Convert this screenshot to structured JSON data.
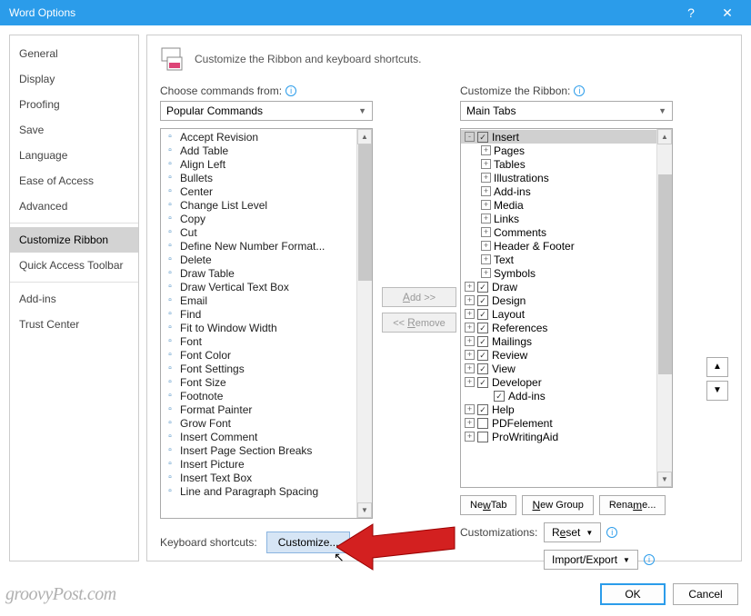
{
  "title": "Word Options",
  "sidebar": {
    "items": [
      "General",
      "Display",
      "Proofing",
      "Save",
      "Language",
      "Ease of Access",
      "Advanced",
      "Customize Ribbon",
      "Quick Access Toolbar",
      "Add-ins",
      "Trust Center"
    ],
    "selected_index": 7
  },
  "header": "Customize the Ribbon and keyboard shortcuts.",
  "left_label": "Choose commands from:",
  "left_dropdown": "Popular Commands",
  "right_label": "Customize the Ribbon:",
  "right_dropdown": "Main Tabs",
  "commands": [
    {
      "label": "Accept Revision",
      "arrow": false
    },
    {
      "label": "Add Table",
      "arrow": true
    },
    {
      "label": "Align Left",
      "arrow": false
    },
    {
      "label": "Bullets",
      "arrow": true
    },
    {
      "label": "Center",
      "arrow": false
    },
    {
      "label": "Change List Level",
      "arrow": true
    },
    {
      "label": "Copy",
      "arrow": false
    },
    {
      "label": "Cut",
      "arrow": false
    },
    {
      "label": "Define New Number Format...",
      "arrow": false
    },
    {
      "label": "Delete",
      "arrow": false
    },
    {
      "label": "Draw Table",
      "arrow": false
    },
    {
      "label": "Draw Vertical Text Box",
      "arrow": false
    },
    {
      "label": "Email",
      "arrow": false
    },
    {
      "label": "Find",
      "arrow": false
    },
    {
      "label": "Fit to Window Width",
      "arrow": false
    },
    {
      "label": "Font",
      "arrow": true
    },
    {
      "label": "Font Color",
      "arrow": true
    },
    {
      "label": "Font Settings",
      "arrow": false
    },
    {
      "label": "Font Size",
      "arrow": true
    },
    {
      "label": "Footnote",
      "arrow": false
    },
    {
      "label": "Format Painter",
      "arrow": false
    },
    {
      "label": "Grow Font",
      "arrow": false
    },
    {
      "label": "Insert Comment",
      "arrow": false
    },
    {
      "label": "Insert Page  Section Breaks",
      "arrow": true
    },
    {
      "label": "Insert Picture",
      "arrow": false
    },
    {
      "label": "Insert Text Box",
      "arrow": false
    },
    {
      "label": "Line and Paragraph Spacing",
      "arrow": true
    }
  ],
  "mid_add": "Add >>",
  "mid_remove": "<< Remove",
  "tree": [
    {
      "indent": 0,
      "exp": "-",
      "chk": true,
      "label": "Insert",
      "sel": true
    },
    {
      "indent": 1,
      "exp": "+",
      "chk": null,
      "label": "Pages"
    },
    {
      "indent": 1,
      "exp": "+",
      "chk": null,
      "label": "Tables"
    },
    {
      "indent": 1,
      "exp": "+",
      "chk": null,
      "label": "Illustrations"
    },
    {
      "indent": 1,
      "exp": "+",
      "chk": null,
      "label": "Add-ins"
    },
    {
      "indent": 1,
      "exp": "+",
      "chk": null,
      "label": "Media"
    },
    {
      "indent": 1,
      "exp": "+",
      "chk": null,
      "label": "Links"
    },
    {
      "indent": 1,
      "exp": "+",
      "chk": null,
      "label": "Comments"
    },
    {
      "indent": 1,
      "exp": "+",
      "chk": null,
      "label": "Header & Footer"
    },
    {
      "indent": 1,
      "exp": "+",
      "chk": null,
      "label": "Text"
    },
    {
      "indent": 1,
      "exp": "+",
      "chk": null,
      "label": "Symbols"
    },
    {
      "indent": 0,
      "exp": "+",
      "chk": true,
      "label": "Draw"
    },
    {
      "indent": 0,
      "exp": "+",
      "chk": true,
      "label": "Design"
    },
    {
      "indent": 0,
      "exp": "+",
      "chk": true,
      "label": "Layout"
    },
    {
      "indent": 0,
      "exp": "+",
      "chk": true,
      "label": "References"
    },
    {
      "indent": 0,
      "exp": "+",
      "chk": true,
      "label": "Mailings"
    },
    {
      "indent": 0,
      "exp": "+",
      "chk": true,
      "label": "Review"
    },
    {
      "indent": 0,
      "exp": "+",
      "chk": true,
      "label": "View"
    },
    {
      "indent": 0,
      "exp": "+",
      "chk": true,
      "label": "Developer"
    },
    {
      "indent": 1,
      "exp": "",
      "chk": true,
      "label": "Add-ins"
    },
    {
      "indent": 0,
      "exp": "+",
      "chk": true,
      "label": "Help"
    },
    {
      "indent": 0,
      "exp": "+",
      "chk": false,
      "label": "PDFelement"
    },
    {
      "indent": 0,
      "exp": "+",
      "chk": false,
      "label": "ProWritingAid"
    }
  ],
  "new_tab": "New Tab",
  "new_group": "New Group",
  "rename": "Rename...",
  "customizations_label": "Customizations:",
  "reset": "Reset",
  "import_export": "Import/Export",
  "kbs_label": "Keyboard shortcuts:",
  "customize_btn": "Customize...",
  "ok": "OK",
  "cancel": "Cancel",
  "watermark": "groovyPost.com"
}
